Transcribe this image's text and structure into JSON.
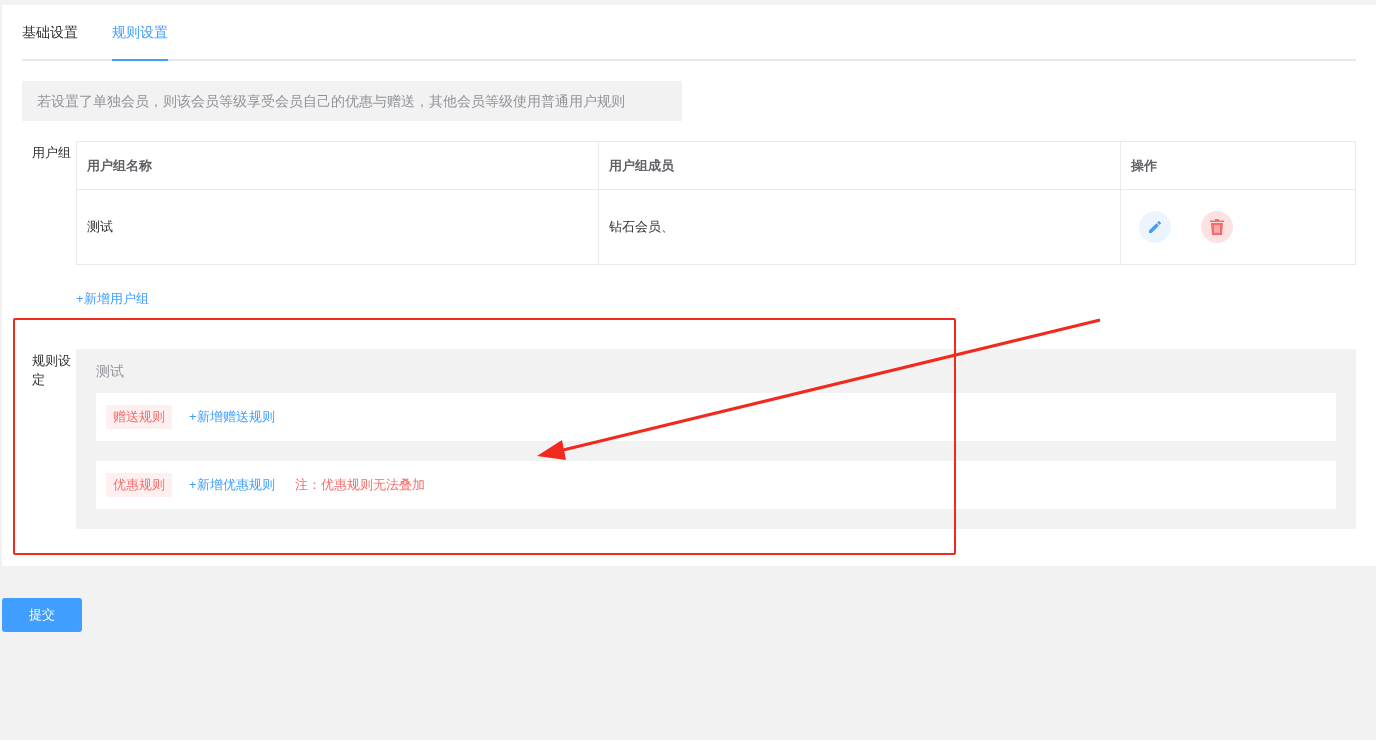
{
  "tabs": [
    {
      "label": "基础设置",
      "selected": false
    },
    {
      "label": "规则设置",
      "selected": true
    }
  ],
  "notice": "若设置了单独会员，则该会员等级享受会员自己的优惠与赠送，其他会员等级使用普通用户规则",
  "user_groups": {
    "label": "用户组",
    "columns": [
      "用户组名称",
      "用户组成员",
      "操作"
    ],
    "rows": [
      {
        "name": "测试",
        "members": "钻石会员、"
      }
    ],
    "add_link": "+新增用户组"
  },
  "rule_settings": {
    "label": "规则设定",
    "groups": [
      {
        "name": "测试",
        "rules": [
          {
            "tag": "赠送规则",
            "add_link": "+新增赠送规则"
          },
          {
            "tag": "优惠规则",
            "add_link": "+新增优惠规则",
            "note": "注：优惠规则无法叠加"
          }
        ]
      }
    ]
  },
  "submit_button": "提交"
}
